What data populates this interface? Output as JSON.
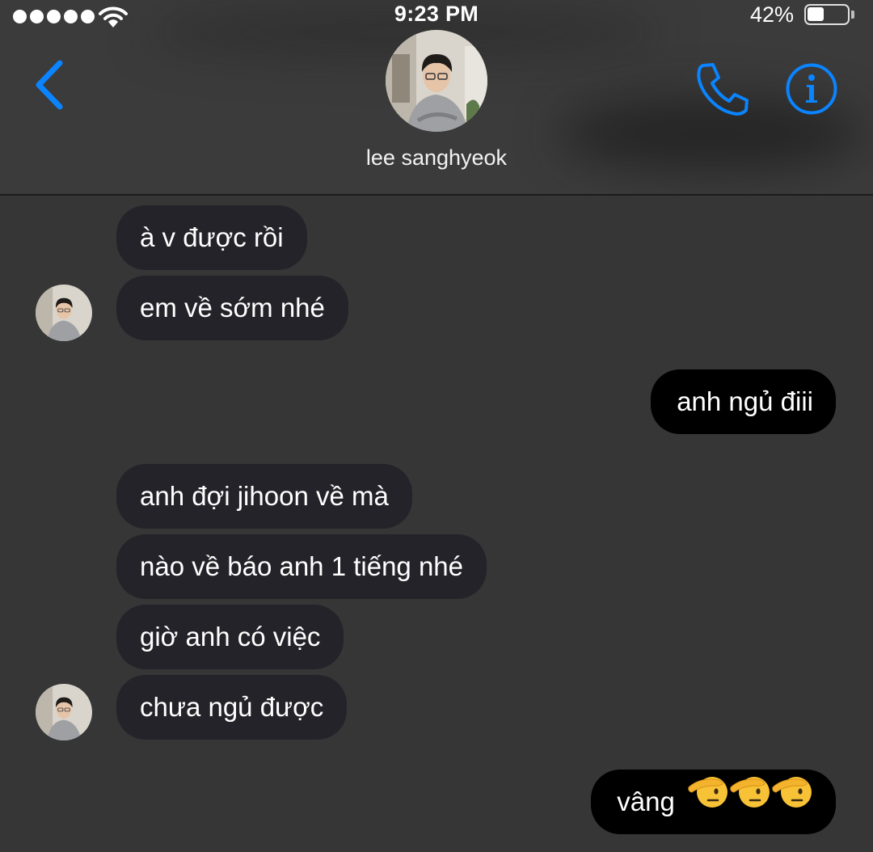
{
  "status_bar": {
    "time": "9:23 PM",
    "battery_percent": "42%",
    "battery_level": 0.42,
    "signal_bars": 5,
    "icons": [
      "signal-dots-icon",
      "wifi-icon",
      "battery-icon"
    ]
  },
  "header": {
    "contact_name": "lee sanghyeok",
    "back_icon": "chevron-left-icon",
    "call_icon": "phone-icon",
    "info_icon": "info-icon",
    "accent_color": "#0a84ff"
  },
  "messages": [
    {
      "side": "incoming",
      "text": "à v được rồi"
    },
    {
      "side": "incoming",
      "text": "em về sớm nhé"
    },
    {
      "side": "outgoing",
      "text": "anh ngủ điii"
    },
    {
      "side": "incoming",
      "text": "anh đợi jihoon về mà"
    },
    {
      "side": "incoming",
      "text": "nào về báo anh 1 tiếng nhé"
    },
    {
      "side": "incoming",
      "text": "giờ anh có việc"
    },
    {
      "side": "incoming",
      "text": "chưa ngủ được"
    },
    {
      "side": "outgoing",
      "text": "vâng",
      "emoji": [
        "saluting-face-emoji",
        "saluting-face-emoji",
        "saluting-face-emoji"
      ]
    }
  ],
  "colors": {
    "background": "#363636",
    "incoming_bubble": "#242329",
    "outgoing_bubble": "#000000"
  }
}
